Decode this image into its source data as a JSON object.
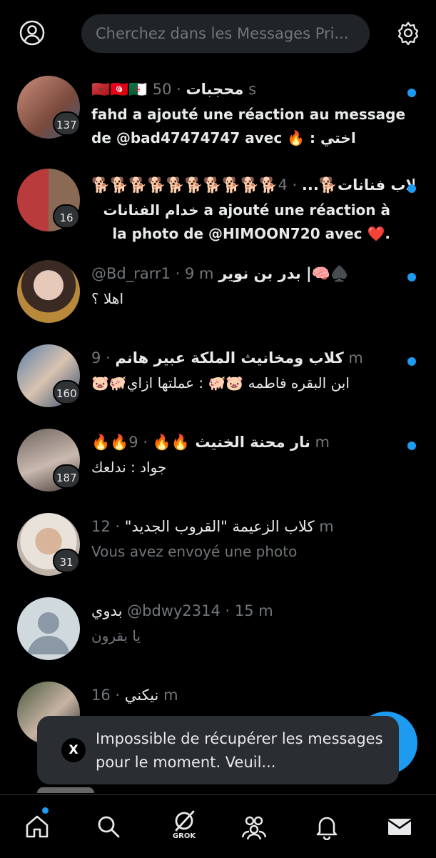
{
  "header": {
    "search_placeholder": "Cherchez dans les Messages Pri...",
    "profile_icon": "profile-icon",
    "settings_icon": "gear-icon"
  },
  "conversations": [
    {
      "name": "🇲🇦🇹🇳🇩🇿 محجبات",
      "meta": "· 50 s",
      "preview": "fahd a ajouté une réaction au message de @bad47474747 avec 🔥 : اختي",
      "badge": "137",
      "unread": true
    },
    {
      "name": "🐕🐕🐕🐕🐕🐕🐕🐕🐕🐕كلاب فنانات🐕...",
      "meta": "· 4 m",
      "preview": "خدام الفنانات a ajouté une réaction à la photo de @HIMOON720 avec ❤️.",
      "badge": "16",
      "unread": true
    },
    {
      "name": "بدر بن نوير |🧠♠️",
      "meta": "@Bd_rarr1 · 9 m",
      "preview": "اهلا ؟",
      "badge": "",
      "unread": true
    },
    {
      "name": "كلاب ومخانيث الملكة عبير هانم",
      "meta": "· 9 m",
      "preview": "🐷🐖ابن البقره فاطمه 🐷🐖 : عملتها ازاي",
      "badge": "160",
      "unread": true
    },
    {
      "name": "🔥🔥نار محنة الخنيث 🔥🔥",
      "meta": "· 9 m",
      "preview": "جواد : ندلعك",
      "badge": "187",
      "unread": true
    },
    {
      "name": "كلاب الزعيمة \"القروب الجديد\"",
      "meta": "· 12 m",
      "preview": "Vous avez envoyé une photo",
      "badge": "31",
      "unread": false
    },
    {
      "name": "بدوي",
      "meta": "@bdwy2314 · 15 m",
      "preview": "يا بقرون",
      "badge": "",
      "unread": false
    },
    {
      "name": "نيكني",
      "meta": "· 16 m",
      "preview": "",
      "badge": "",
      "unread": false
    }
  ],
  "toast": {
    "logo": "X",
    "message": "Impossible de récupérer les messages pour le moment. Veuil..."
  },
  "tabs": {
    "grok_label": "GROK"
  },
  "colors": {
    "accent": "#1d9bf0",
    "background": "#000000",
    "muted": "#71767b"
  }
}
